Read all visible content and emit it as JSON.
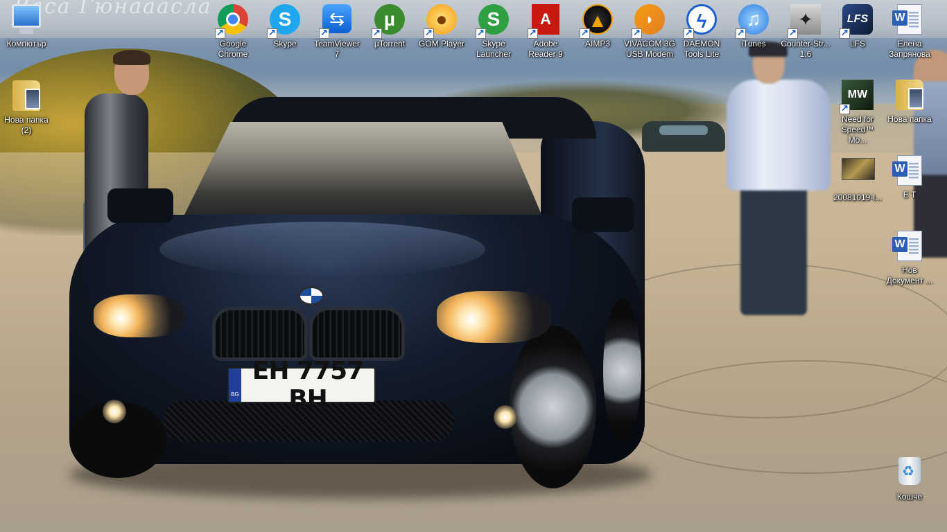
{
  "wallpaper": {
    "plate_number": "EH 7757 BH",
    "plate_country": "BG",
    "watermark_text": "Васa Гюнааасла"
  },
  "desktop": {
    "icons": [
      {
        "id": "computer",
        "label": "Компютър",
        "icon": "computer-icon",
        "shortcut": false
      },
      {
        "id": "new-folder-2",
        "label": "Нова папка\n(2)",
        "icon": "folder-icon",
        "shortcut": false
      },
      {
        "id": "google-chrome",
        "label": "Google\nChrome",
        "icon": "chrome-icon",
        "shortcut": true
      },
      {
        "id": "skype",
        "label": "Skype",
        "icon": "skype-icon",
        "shortcut": true
      },
      {
        "id": "teamviewer",
        "label": "TeamViewer\n7",
        "icon": "teamviewer-icon",
        "shortcut": true
      },
      {
        "id": "utorrent",
        "label": "µTorrent",
        "icon": "utorrent-icon",
        "shortcut": true
      },
      {
        "id": "gom-player",
        "label": "GOM Player",
        "icon": "gom-player-icon",
        "shortcut": true
      },
      {
        "id": "skype-launcher",
        "label": "Skype\nLauncher",
        "icon": "skype-launcher-icon",
        "shortcut": true
      },
      {
        "id": "adobe-reader",
        "label": "Adobe\nReader 9",
        "icon": "adobe-reader-icon",
        "shortcut": true
      },
      {
        "id": "aimp3",
        "label": "AIMP3",
        "icon": "aimp-icon",
        "shortcut": true
      },
      {
        "id": "vivacom",
        "label": "VIVACOM 3G\nUSB Modem",
        "icon": "vivacom-icon",
        "shortcut": true
      },
      {
        "id": "daemon-tools",
        "label": "DAEMON\nTools Lite",
        "icon": "daemon-tools-icon",
        "shortcut": true
      },
      {
        "id": "itunes",
        "label": "iTunes",
        "icon": "itunes-icon",
        "shortcut": true
      },
      {
        "id": "counter-strike",
        "label": "Counter-Str...\n1.6",
        "icon": "counter-strike-icon",
        "shortcut": true
      },
      {
        "id": "lfs",
        "label": "LFS",
        "icon": "lfs-icon",
        "shortcut": true
      },
      {
        "id": "elena-doc",
        "label": "Елена\nЗапрянова",
        "icon": "word-document-icon",
        "shortcut": false
      },
      {
        "id": "nfs-mw",
        "label": "Need for\nSpeed™ Mo...",
        "icon": "nfs-most-wanted-icon",
        "shortcut": true
      },
      {
        "id": "new-folder",
        "label": "Нова папка",
        "icon": "folder-icon",
        "shortcut": false
      },
      {
        "id": "photo-2008",
        "label": "20081019-l...",
        "icon": "image-file-icon",
        "shortcut": false
      },
      {
        "id": "et-doc",
        "label": "E T",
        "icon": "word-document-icon",
        "shortcut": false
      },
      {
        "id": "new-doc",
        "label": "Нов\nДокумент ...",
        "icon": "word-document-icon",
        "shortcut": false
      },
      {
        "id": "recycle-bin",
        "label": "Кошче",
        "icon": "recycle-bin-icon",
        "shortcut": false
      }
    ]
  }
}
